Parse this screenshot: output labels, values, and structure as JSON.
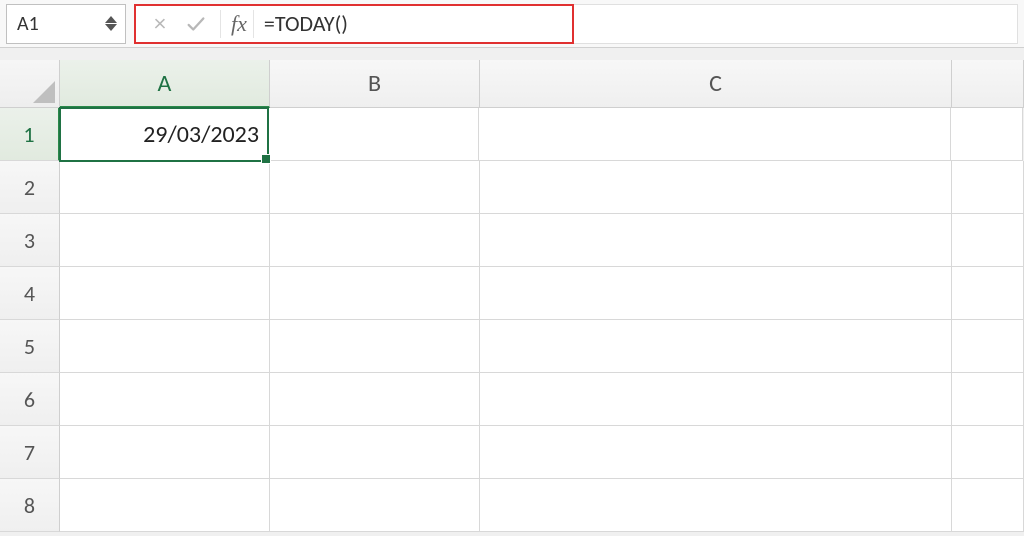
{
  "name_box": {
    "value": "A1"
  },
  "formula_bar": {
    "fx_label": "fx",
    "formula": "=TODAY()"
  },
  "columns": [
    {
      "label": "A",
      "cls": "col-A",
      "active": true
    },
    {
      "label": "B",
      "cls": "col-B",
      "active": false
    },
    {
      "label": "C",
      "cls": "col-C",
      "active": false
    },
    {
      "label": "",
      "cls": "col-D",
      "active": false
    }
  ],
  "rows": [
    {
      "label": "1",
      "active": true
    },
    {
      "label": "2",
      "active": false
    },
    {
      "label": "3",
      "active": false
    },
    {
      "label": "4",
      "active": false
    },
    {
      "label": "5",
      "active": false
    },
    {
      "label": "6",
      "active": false
    },
    {
      "label": "7",
      "active": false
    },
    {
      "label": "8",
      "active": false
    }
  ],
  "active_cell": {
    "row": 0,
    "col": 0,
    "value": "29/03/2023"
  }
}
